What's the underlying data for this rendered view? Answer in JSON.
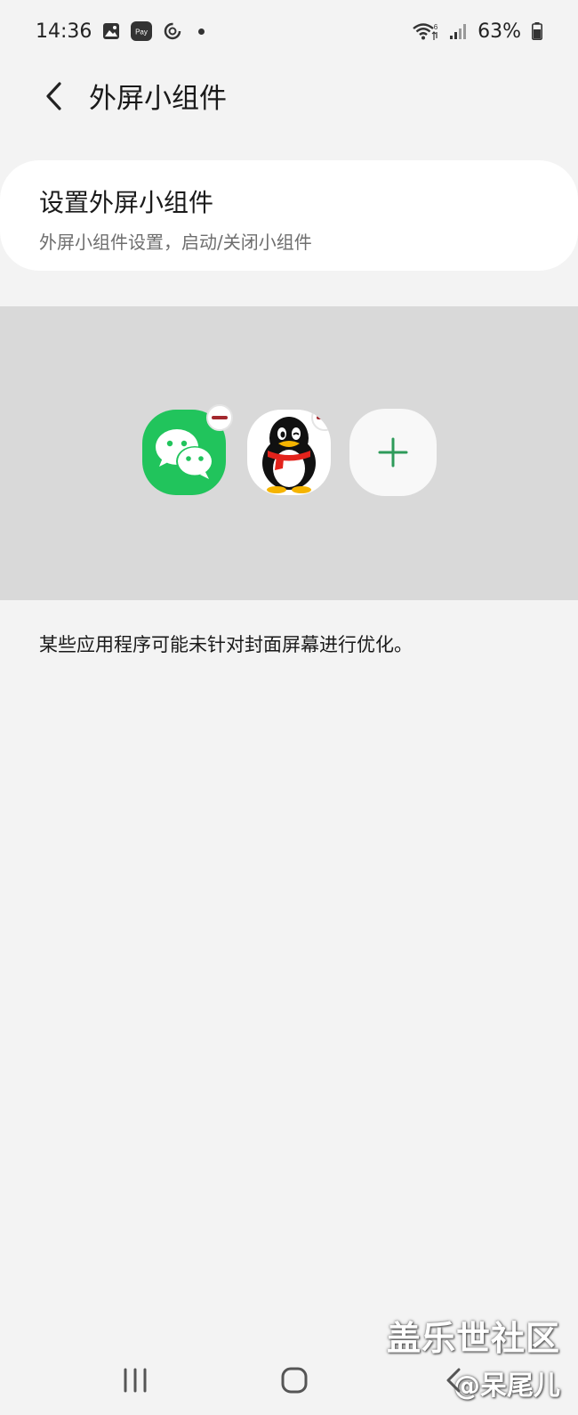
{
  "status_bar": {
    "time": "14:36",
    "battery_percent": "63%",
    "pay_label": "Pay",
    "network_label": "6"
  },
  "header": {
    "title": "外屏小组件"
  },
  "settings_card": {
    "title": "设置外屏小组件",
    "subtitle": "外屏小组件设置，启动/关闭小组件"
  },
  "widgets": [
    {
      "name": "WeChat",
      "icon": "wechat-icon",
      "color": "#21c45c"
    },
    {
      "name": "QQ",
      "icon": "qq-penguin-icon",
      "color": "#ffffff"
    }
  ],
  "notice": {
    "text": "某些应用程序可能未针对封面屏幕进行优化。"
  },
  "watermark": {
    "line1": "盖乐世社区",
    "line2": "@呆尾儿"
  },
  "colors": {
    "background": "#f3f3f3",
    "card": "#ffffff",
    "preview_panel": "#d9d9d9",
    "accent_green": "#2e9b5a",
    "remove_red": "#a3282e"
  }
}
